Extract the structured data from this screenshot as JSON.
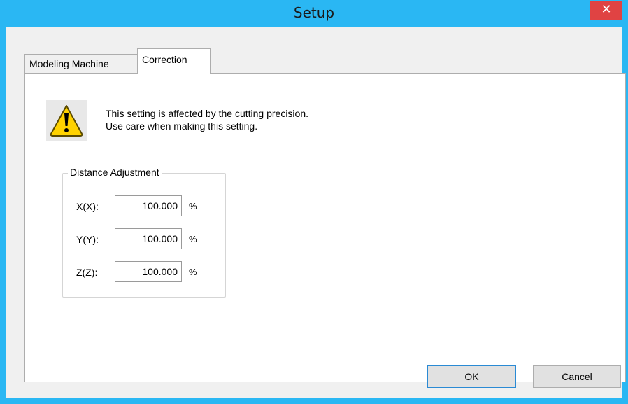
{
  "window": {
    "title": "Setup",
    "close_glyph": "✕",
    "frame_color": "#2ab7f3",
    "close_color": "#e04343"
  },
  "tabs": [
    {
      "label": "Modeling Machine",
      "active": false
    },
    {
      "label": "Correction",
      "active": true
    }
  ],
  "warning": {
    "icon": "warning-icon",
    "line1": "This setting is affected by the cutting precision.",
    "line2": "Use care when making this setting."
  },
  "distance_adjustment": {
    "legend": "Distance Adjustment",
    "rows": [
      {
        "label_pre": "X(",
        "label_mnemonic": "X",
        "label_post": "):",
        "value": "100.000",
        "unit": "%"
      },
      {
        "label_pre": "Y(",
        "label_mnemonic": "Y",
        "label_post": "):",
        "value": "100.000",
        "unit": "%"
      },
      {
        "label_pre": "Z(",
        "label_mnemonic": "Z",
        "label_post": "):",
        "value": "100.000",
        "unit": "%"
      }
    ]
  },
  "buttons": {
    "ok": "OK",
    "cancel": "Cancel"
  }
}
